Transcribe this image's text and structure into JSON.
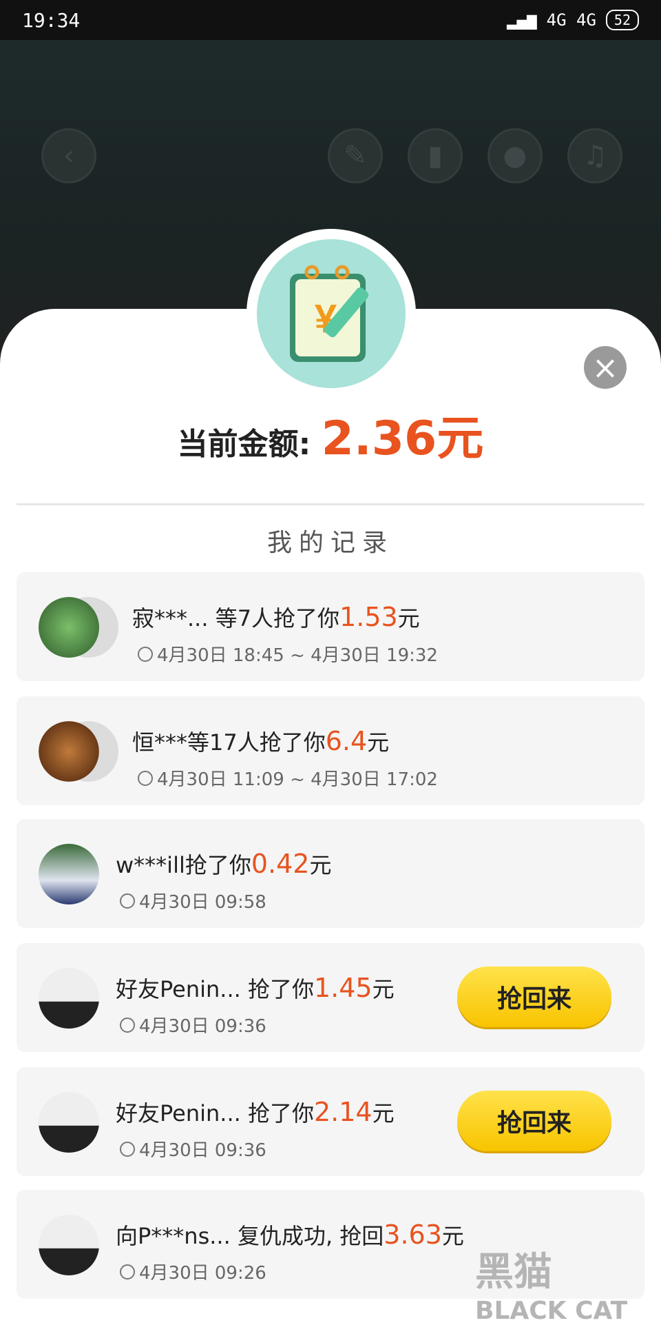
{
  "status_bar": {
    "time": "19:34",
    "network": "4G 4G",
    "battery": "52"
  },
  "top_icons": [
    "back-icon",
    "edit-icon",
    "stats-icon",
    "moneybag-icon",
    "music-icon"
  ],
  "badge_symbol": "¥",
  "close_label": "×",
  "balance": {
    "label": "当前金额:",
    "amount": "2.36元"
  },
  "section_title": "我的记录",
  "records": [
    {
      "name": "寂***... 等7人抢了你",
      "amount": "1.53",
      "unit": "元",
      "time": "4月30日 18:45 ~ 4月30日 19:32"
    },
    {
      "name": "恒***等17人抢了你",
      "amount": "6.4",
      "unit": "元",
      "time": "4月30日 11:09 ~ 4月30日 17:02"
    },
    {
      "name": "w***ill抢了你",
      "amount": "0.42",
      "unit": "元",
      "time": "4月30日 09:58"
    },
    {
      "name": "好友Penin... 抢了你",
      "amount": "1.45",
      "unit": "元",
      "time": "4月30日 09:36",
      "button": "抢回来"
    },
    {
      "name": "好友Penin... 抢了你",
      "amount": "2.14",
      "unit": "元",
      "time": "4月30日 09:36",
      "button": "抢回来"
    },
    {
      "name": "向P***ns... 复仇成功, 抢回",
      "amount": "3.63",
      "unit": "元",
      "time": "4月30日 09:26"
    }
  ],
  "watermark": {
    "cn": "黑猫",
    "en": "BLACK CAT"
  }
}
